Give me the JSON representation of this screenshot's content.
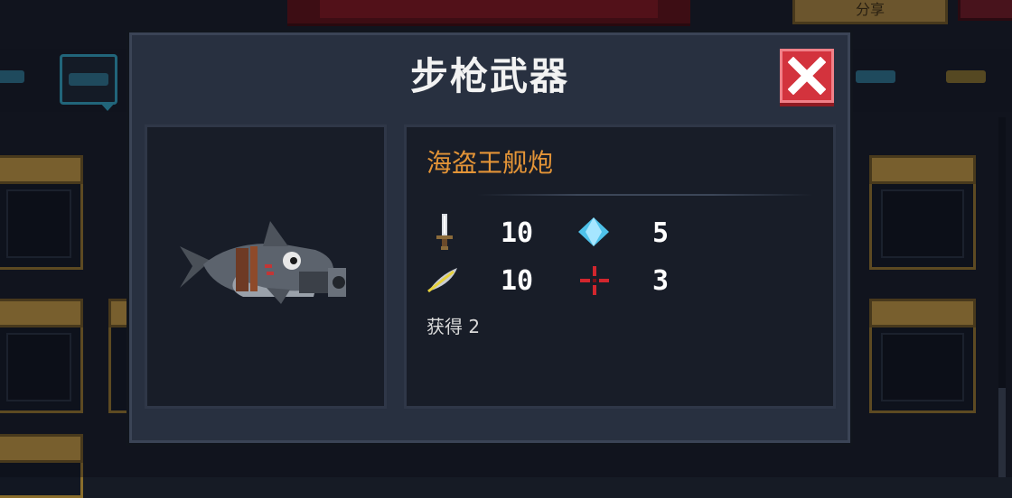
{
  "background": {
    "top_button_label": "分享"
  },
  "dialog": {
    "title": "步枪武器",
    "close_icon": "close-x-icon",
    "weapon": {
      "name": "海盗王舰炮",
      "icon": "shark-cannon-icon",
      "stats": {
        "damage": {
          "icon": "sword-icon",
          "value": "10"
        },
        "energy_cost": {
          "icon": "blue-crystal-icon",
          "value": "5"
        },
        "crit": {
          "icon": "feather-icon",
          "value": "10"
        },
        "accuracy": {
          "icon": "red-crosshair-icon",
          "value": "3"
        }
      },
      "obtained_text": "获得 2"
    }
  },
  "colors": {
    "name_accent": "#e39437",
    "close_red": "#d3333d",
    "tab_highlight": "#2e97b3"
  }
}
